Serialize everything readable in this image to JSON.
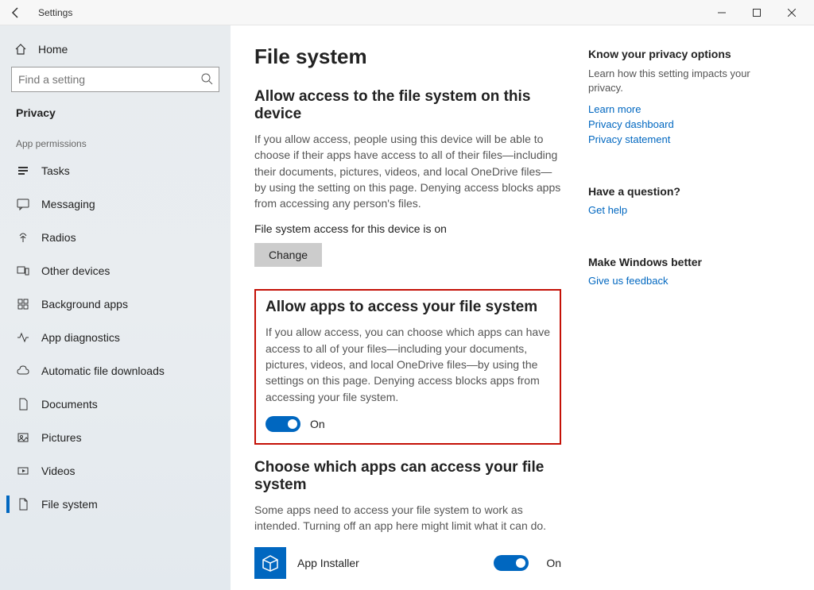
{
  "titlebar": {
    "title": "Settings"
  },
  "sidebar": {
    "home": "Home",
    "search_placeholder": "Find a setting",
    "category": "Privacy",
    "section_label": "App permissions",
    "items": [
      {
        "label": "Tasks"
      },
      {
        "label": "Messaging"
      },
      {
        "label": "Radios"
      },
      {
        "label": "Other devices"
      },
      {
        "label": "Background apps"
      },
      {
        "label": "App diagnostics"
      },
      {
        "label": "Automatic file downloads"
      },
      {
        "label": "Documents"
      },
      {
        "label": "Pictures"
      },
      {
        "label": "Videos"
      },
      {
        "label": "File system"
      }
    ]
  },
  "main": {
    "page_title": "File system",
    "section1": {
      "title": "Allow access to the file system on this device",
      "desc": "If you allow access, people using this device will be able to choose if their apps have access to all of their files—including their documents, pictures, videos, and local OneDrive files—by using the setting on this page. Denying access blocks apps from accessing any person's files.",
      "status": "File system access for this device is on",
      "button": "Change"
    },
    "section2": {
      "title": "Allow apps to access your file system",
      "desc": "If you allow access, you can choose which apps can have access to all of your files—including your documents, pictures, videos, and local OneDrive files—by using the settings on this page. Denying access blocks apps from accessing your file system.",
      "toggle_state": "On"
    },
    "section3": {
      "title": "Choose which apps can access your file system",
      "desc": "Some apps need to access your file system to work as intended. Turning off an app here might limit what it can do.",
      "apps": [
        {
          "name": "App Installer",
          "state": "On"
        }
      ]
    }
  },
  "right": {
    "g1": {
      "title": "Know your privacy options",
      "desc": "Learn how this setting impacts your privacy.",
      "links": [
        "Learn more",
        "Privacy dashboard",
        "Privacy statement"
      ]
    },
    "g2": {
      "title": "Have a question?",
      "links": [
        "Get help"
      ]
    },
    "g3": {
      "title": "Make Windows better",
      "links": [
        "Give us feedback"
      ]
    }
  }
}
